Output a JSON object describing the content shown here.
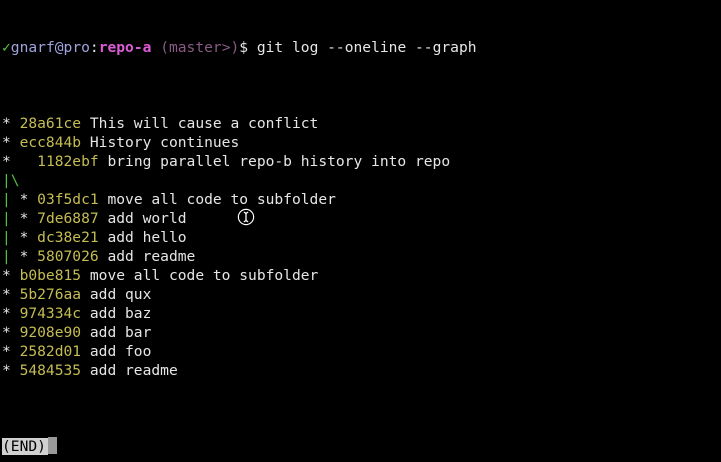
{
  "prompt": {
    "status_icon": "check-icon",
    "status_glyph": "✓",
    "user": "gnarf",
    "at": "@",
    "host": "pro",
    "colon": ":",
    "dir": "repo-a",
    "branch": " (master>)",
    "symbol": "$ ",
    "command": "git log --oneline --graph"
  },
  "log": [
    {
      "graph": "* ",
      "graph_color": "default",
      "hash": "28a61ce",
      "message": " This will cause a conflict"
    },
    {
      "graph": "* ",
      "graph_color": "default",
      "hash": "ecc844b",
      "message": " History continues"
    },
    {
      "graph": "*   ",
      "graph_color": "default",
      "hash": "1182ebf",
      "message": " bring parallel repo-b history into repo"
    },
    {
      "graph": "|\\",
      "graph_color": "green",
      "hash": "",
      "message": ""
    },
    {
      "graph": "| ",
      "graph_color": "green",
      "graph2": "* ",
      "hash": "03f5dc1",
      "message": " move all code to subfolder"
    },
    {
      "graph": "| ",
      "graph_color": "green",
      "graph2": "* ",
      "hash": "7de6887",
      "message": " add world"
    },
    {
      "graph": "| ",
      "graph_color": "green",
      "graph2": "* ",
      "hash": "dc38e21",
      "message": " add hello"
    },
    {
      "graph": "| ",
      "graph_color": "green",
      "graph2": "* ",
      "hash": "5807026",
      "message": " add readme"
    },
    {
      "graph": "* ",
      "graph_color": "default",
      "hash": "b0be815",
      "message": " move all code to subfolder"
    },
    {
      "graph": "* ",
      "graph_color": "default",
      "hash": "5b276aa",
      "message": " add qux"
    },
    {
      "graph": "* ",
      "graph_color": "default",
      "hash": "974334c",
      "message": " add baz"
    },
    {
      "graph": "* ",
      "graph_color": "default",
      "hash": "9208e90",
      "message": " add bar"
    },
    {
      "graph": "* ",
      "graph_color": "default",
      "hash": "2582d01",
      "message": " add foo"
    },
    {
      "graph": "* ",
      "graph_color": "default",
      "hash": "5484535",
      "message": " add readme"
    }
  ],
  "pager": {
    "end_label": "(END)"
  },
  "colors": {
    "background": "#000000",
    "text": "#e6e6e6",
    "hash": "#c5bd53",
    "check": "#56c83a",
    "user_host": "#9fa4dd",
    "dir": "#dc5cd6",
    "branch": "#8a5a86",
    "graph_branch": "#4ec23a"
  },
  "mouse_pointer": "text-cursor-icon"
}
